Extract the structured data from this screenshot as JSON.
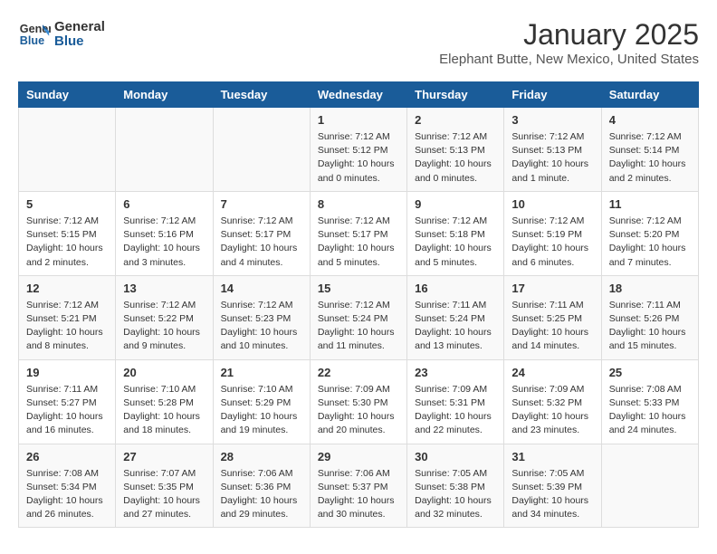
{
  "header": {
    "logo_line1": "General",
    "logo_line2": "Blue",
    "month": "January 2025",
    "location": "Elephant Butte, New Mexico, United States"
  },
  "days_of_week": [
    "Sunday",
    "Monday",
    "Tuesday",
    "Wednesday",
    "Thursday",
    "Friday",
    "Saturday"
  ],
  "weeks": [
    [
      {
        "day": "",
        "info": ""
      },
      {
        "day": "",
        "info": ""
      },
      {
        "day": "",
        "info": ""
      },
      {
        "day": "1",
        "info": "Sunrise: 7:12 AM\nSunset: 5:12 PM\nDaylight: 10 hours\nand 0 minutes."
      },
      {
        "day": "2",
        "info": "Sunrise: 7:12 AM\nSunset: 5:13 PM\nDaylight: 10 hours\nand 0 minutes."
      },
      {
        "day": "3",
        "info": "Sunrise: 7:12 AM\nSunset: 5:13 PM\nDaylight: 10 hours\nand 1 minute."
      },
      {
        "day": "4",
        "info": "Sunrise: 7:12 AM\nSunset: 5:14 PM\nDaylight: 10 hours\nand 2 minutes."
      }
    ],
    [
      {
        "day": "5",
        "info": "Sunrise: 7:12 AM\nSunset: 5:15 PM\nDaylight: 10 hours\nand 2 minutes."
      },
      {
        "day": "6",
        "info": "Sunrise: 7:12 AM\nSunset: 5:16 PM\nDaylight: 10 hours\nand 3 minutes."
      },
      {
        "day": "7",
        "info": "Sunrise: 7:12 AM\nSunset: 5:17 PM\nDaylight: 10 hours\nand 4 minutes."
      },
      {
        "day": "8",
        "info": "Sunrise: 7:12 AM\nSunset: 5:17 PM\nDaylight: 10 hours\nand 5 minutes."
      },
      {
        "day": "9",
        "info": "Sunrise: 7:12 AM\nSunset: 5:18 PM\nDaylight: 10 hours\nand 5 minutes."
      },
      {
        "day": "10",
        "info": "Sunrise: 7:12 AM\nSunset: 5:19 PM\nDaylight: 10 hours\nand 6 minutes."
      },
      {
        "day": "11",
        "info": "Sunrise: 7:12 AM\nSunset: 5:20 PM\nDaylight: 10 hours\nand 7 minutes."
      }
    ],
    [
      {
        "day": "12",
        "info": "Sunrise: 7:12 AM\nSunset: 5:21 PM\nDaylight: 10 hours\nand 8 minutes."
      },
      {
        "day": "13",
        "info": "Sunrise: 7:12 AM\nSunset: 5:22 PM\nDaylight: 10 hours\nand 9 minutes."
      },
      {
        "day": "14",
        "info": "Sunrise: 7:12 AM\nSunset: 5:23 PM\nDaylight: 10 hours\nand 10 minutes."
      },
      {
        "day": "15",
        "info": "Sunrise: 7:12 AM\nSunset: 5:24 PM\nDaylight: 10 hours\nand 11 minutes."
      },
      {
        "day": "16",
        "info": "Sunrise: 7:11 AM\nSunset: 5:24 PM\nDaylight: 10 hours\nand 13 minutes."
      },
      {
        "day": "17",
        "info": "Sunrise: 7:11 AM\nSunset: 5:25 PM\nDaylight: 10 hours\nand 14 minutes."
      },
      {
        "day": "18",
        "info": "Sunrise: 7:11 AM\nSunset: 5:26 PM\nDaylight: 10 hours\nand 15 minutes."
      }
    ],
    [
      {
        "day": "19",
        "info": "Sunrise: 7:11 AM\nSunset: 5:27 PM\nDaylight: 10 hours\nand 16 minutes."
      },
      {
        "day": "20",
        "info": "Sunrise: 7:10 AM\nSunset: 5:28 PM\nDaylight: 10 hours\nand 18 minutes."
      },
      {
        "day": "21",
        "info": "Sunrise: 7:10 AM\nSunset: 5:29 PM\nDaylight: 10 hours\nand 19 minutes."
      },
      {
        "day": "22",
        "info": "Sunrise: 7:09 AM\nSunset: 5:30 PM\nDaylight: 10 hours\nand 20 minutes."
      },
      {
        "day": "23",
        "info": "Sunrise: 7:09 AM\nSunset: 5:31 PM\nDaylight: 10 hours\nand 22 minutes."
      },
      {
        "day": "24",
        "info": "Sunrise: 7:09 AM\nSunset: 5:32 PM\nDaylight: 10 hours\nand 23 minutes."
      },
      {
        "day": "25",
        "info": "Sunrise: 7:08 AM\nSunset: 5:33 PM\nDaylight: 10 hours\nand 24 minutes."
      }
    ],
    [
      {
        "day": "26",
        "info": "Sunrise: 7:08 AM\nSunset: 5:34 PM\nDaylight: 10 hours\nand 26 minutes."
      },
      {
        "day": "27",
        "info": "Sunrise: 7:07 AM\nSunset: 5:35 PM\nDaylight: 10 hours\nand 27 minutes."
      },
      {
        "day": "28",
        "info": "Sunrise: 7:06 AM\nSunset: 5:36 PM\nDaylight: 10 hours\nand 29 minutes."
      },
      {
        "day": "29",
        "info": "Sunrise: 7:06 AM\nSunset: 5:37 PM\nDaylight: 10 hours\nand 30 minutes."
      },
      {
        "day": "30",
        "info": "Sunrise: 7:05 AM\nSunset: 5:38 PM\nDaylight: 10 hours\nand 32 minutes."
      },
      {
        "day": "31",
        "info": "Sunrise: 7:05 AM\nSunset: 5:39 PM\nDaylight: 10 hours\nand 34 minutes."
      },
      {
        "day": "",
        "info": ""
      }
    ]
  ]
}
